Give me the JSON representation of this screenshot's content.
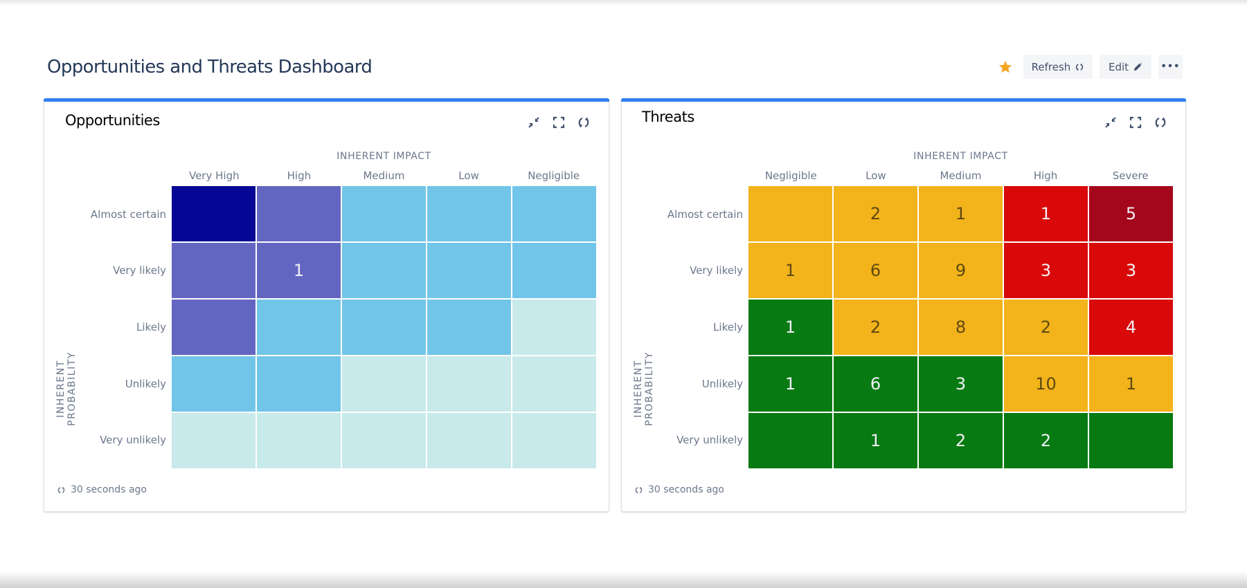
{
  "header": {
    "title": "Opportunities and Threats Dashboard",
    "star_icon": "star-icon",
    "star_color": "#f5a623",
    "refresh_label": "Refresh",
    "edit_label": "Edit",
    "more_label": "•••"
  },
  "colors": {
    "accent_bar": "#2f80ed",
    "text_dark": "#253858",
    "text_muted": "#6b778c"
  },
  "chart_data": [
    {
      "type": "heatmap",
      "title": "Opportunities",
      "xlabel": "INHERENT IMPACT",
      "ylabel": "INHERENT PROBABILITY",
      "x": [
        "Very High",
        "High",
        "Medium",
        "Low",
        "Negligible"
      ],
      "y": [
        "Almost certain",
        "Very likely",
        "Likely",
        "Unlikely",
        "Very unlikely"
      ],
      "values": [
        [
          null,
          null,
          null,
          null,
          null
        ],
        [
          null,
          1,
          null,
          null,
          null
        ],
        [
          null,
          null,
          null,
          null,
          null
        ],
        [
          null,
          null,
          null,
          null,
          null
        ],
        [
          null,
          null,
          null,
          null,
          null
        ]
      ],
      "cell_colors": [
        [
          "#050596",
          "#6366c0",
          "#71c5e8",
          "#71c5e8",
          "#71c5e8"
        ],
        [
          "#6366c0",
          "#6366c0",
          "#71c5e8",
          "#71c5e8",
          "#71c5e8"
        ],
        [
          "#6366c0",
          "#71c5e8",
          "#71c5e8",
          "#71c5e8",
          "#c8eaea"
        ],
        [
          "#71c5e8",
          "#71c5e8",
          "#c8eaea",
          "#c8eaea",
          "#c8eaea"
        ],
        [
          "#c8eaea",
          "#c8eaea",
          "#c8eaea",
          "#c8eaea",
          "#c8eaea"
        ]
      ],
      "footer": "30 seconds ago"
    },
    {
      "type": "heatmap",
      "title": "Threats",
      "xlabel": "INHERENT IMPACT",
      "ylabel": "INHERENT PROBABILITY",
      "x": [
        "Negligible",
        "Low",
        "Medium",
        "High",
        "Severe"
      ],
      "y": [
        "Almost certain",
        "Very likely",
        "Likely",
        "Unlikely",
        "Very unlikely"
      ],
      "values": [
        [
          null,
          2,
          1,
          1,
          5
        ],
        [
          1,
          6,
          9,
          3,
          3
        ],
        [
          1,
          2,
          8,
          2,
          4
        ],
        [
          1,
          6,
          3,
          10,
          1
        ],
        [
          null,
          1,
          2,
          2,
          null
        ]
      ],
      "cell_colors": [
        [
          "#f3b31b",
          "#f3b31b",
          "#f3b31b",
          "#d90909",
          "#a4061b"
        ],
        [
          "#f3b31b",
          "#f3b31b",
          "#f3b31b",
          "#d90909",
          "#d90909"
        ],
        [
          "#087a12",
          "#f3b31b",
          "#f3b31b",
          "#f3b31b",
          "#d90909"
        ],
        [
          "#087a12",
          "#087a12",
          "#087a12",
          "#f3b31b",
          "#f3b31b"
        ],
        [
          "#087a12",
          "#087a12",
          "#087a12",
          "#087a12",
          "#087a12"
        ]
      ],
      "footer": "30 seconds ago"
    }
  ]
}
